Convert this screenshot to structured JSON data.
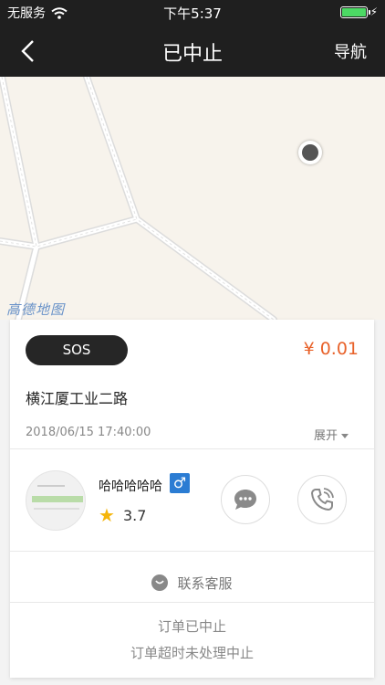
{
  "status_bar": {
    "carrier": "无服务",
    "time": "下午5:37"
  },
  "nav": {
    "title": "已中止",
    "right_action": "导航"
  },
  "map": {
    "provider_logo": "高德地图"
  },
  "order": {
    "sos_label": "SOS",
    "price": "¥ 0.01",
    "address": "横江厦工业二路",
    "datetime": "2018/06/15 17:40:00",
    "expand_label": "展开"
  },
  "driver": {
    "name": "哈哈哈哈哈",
    "gender_symbol": "♂",
    "rating": "3.7"
  },
  "actions": {
    "message_icon": "chat-bubble-icon",
    "phone_icon": "phone-icon"
  },
  "service": {
    "label": "联系客服"
  },
  "status": {
    "line1": "订单已中止",
    "line2": "订单超时未处理中止"
  },
  "colors": {
    "accent_price": "#e8622a",
    "nav_bg": "#1f1f1f",
    "gender_bg": "#2b7cd3",
    "star": "#f5b50a",
    "battery": "#4cd964"
  }
}
